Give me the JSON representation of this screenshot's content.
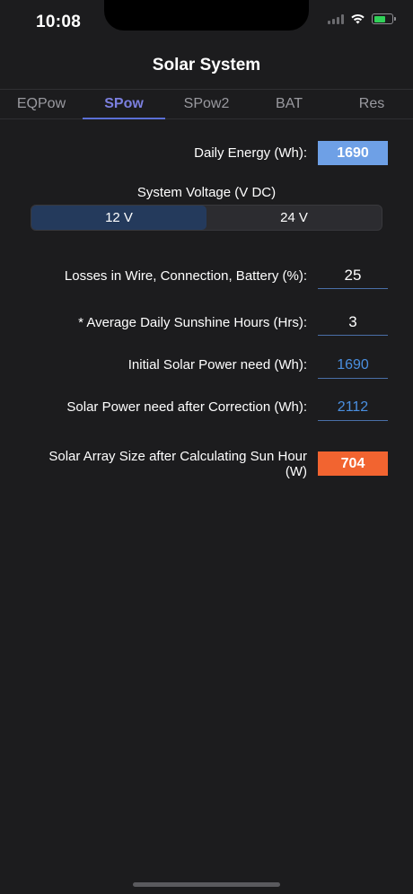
{
  "status_bar": {
    "time": "10:08"
  },
  "nav": {
    "title": "Solar System"
  },
  "tabs": [
    {
      "label": "EQPow",
      "active": false
    },
    {
      "label": "SPow",
      "active": true
    },
    {
      "label": "SPow2",
      "active": false
    },
    {
      "label": "BAT",
      "active": false
    },
    {
      "label": "Res",
      "active": false
    }
  ],
  "form": {
    "daily_energy": {
      "label": "Daily Energy (Wh):",
      "value": "1690"
    },
    "system_voltage": {
      "label": "System Voltage (V DC)",
      "options": [
        "12 V",
        "24 V"
      ],
      "selected": "12 V"
    },
    "losses": {
      "label": "Losses in Wire, Connection, Battery (%):",
      "value": "25"
    },
    "sunshine": {
      "label": "* Average Daily Sunshine Hours (Hrs):",
      "value": "3"
    },
    "initial_power": {
      "label": "Initial Solar Power need (Wh):",
      "value": "1690"
    },
    "corrected_power": {
      "label": "Solar Power need after Correction (Wh):",
      "value": "2112"
    },
    "array_size": {
      "label": "Solar Array Size after Calculating Sun Hour (W)",
      "value": "704"
    }
  },
  "colors": {
    "background": "#1c1c1e",
    "accent": "#7b7fdf",
    "daily_box": "#6ea0e6",
    "result_box": "#f26430",
    "calc_text": "#4a8fe0"
  }
}
